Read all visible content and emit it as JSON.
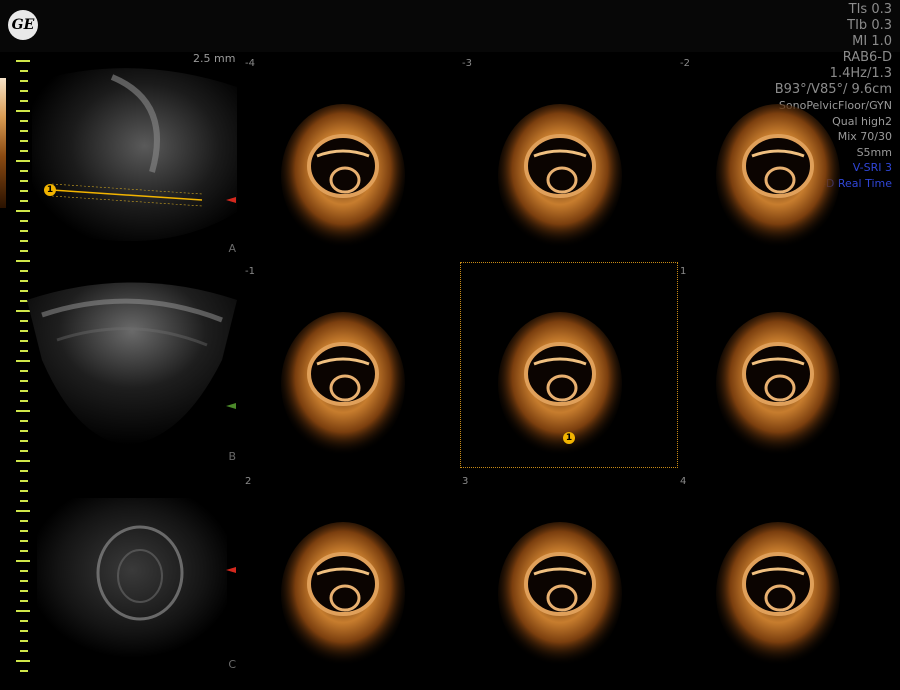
{
  "header": {
    "logo_text": "GE",
    "tis": "TIs 0.3",
    "tib": "TIb 0.3",
    "mi": "MI  1.0",
    "probe": "RAB6-D",
    "freq": "1.4Hz/1.3",
    "geometry": "B93°/V85°/ 9.6cm",
    "preset": "SonoPelvicFloor/GYN",
    "quality": "Qual high2",
    "mix": "Mix 70/30",
    "slice": "S5mm",
    "vsri": "V-SRI 3",
    "mode": "4D Real Time"
  },
  "left_panels": {
    "slice_thickness": "2.5 mm",
    "labels": [
      "A",
      "B",
      "C"
    ]
  },
  "tomographic_slices": [
    "-4",
    "-3",
    "-2",
    "-1",
    "",
    "1",
    "2",
    "3",
    "4"
  ],
  "marker_label": "1",
  "colors": {
    "accent": "#f2b400",
    "marker_ruler": "#cfe64a",
    "blue_text": "#3046d8"
  }
}
